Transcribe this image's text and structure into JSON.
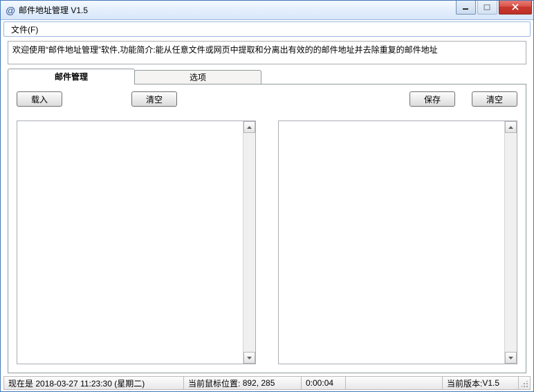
{
  "window": {
    "title": "邮件地址管理 V1.5",
    "icon_glyph": "@"
  },
  "menu": {
    "file": "文件(F)"
  },
  "description": "欢迎使用“邮件地址管理”软件,功能简介:能从任意文件或网页中提取和分离出有效的的邮件地址并去除重复的邮件地址",
  "tabs": {
    "mail_mgmt": "邮件管理",
    "options": "选项"
  },
  "buttons": {
    "load": "载入",
    "clear_left": "清空",
    "save": "保存",
    "clear_right": "清空"
  },
  "textareas": {
    "left_value": "",
    "right_value": ""
  },
  "status": {
    "now_prefix": "现在是",
    "now_value": "2018-03-27 11:23:30 (星期二)",
    "mouse_prefix": "当前鼠标位置:",
    "mouse_value": "892, 285",
    "elapsed": "0:00:04",
    "version_prefix": "当前版本:",
    "version_value": "V1.5"
  }
}
